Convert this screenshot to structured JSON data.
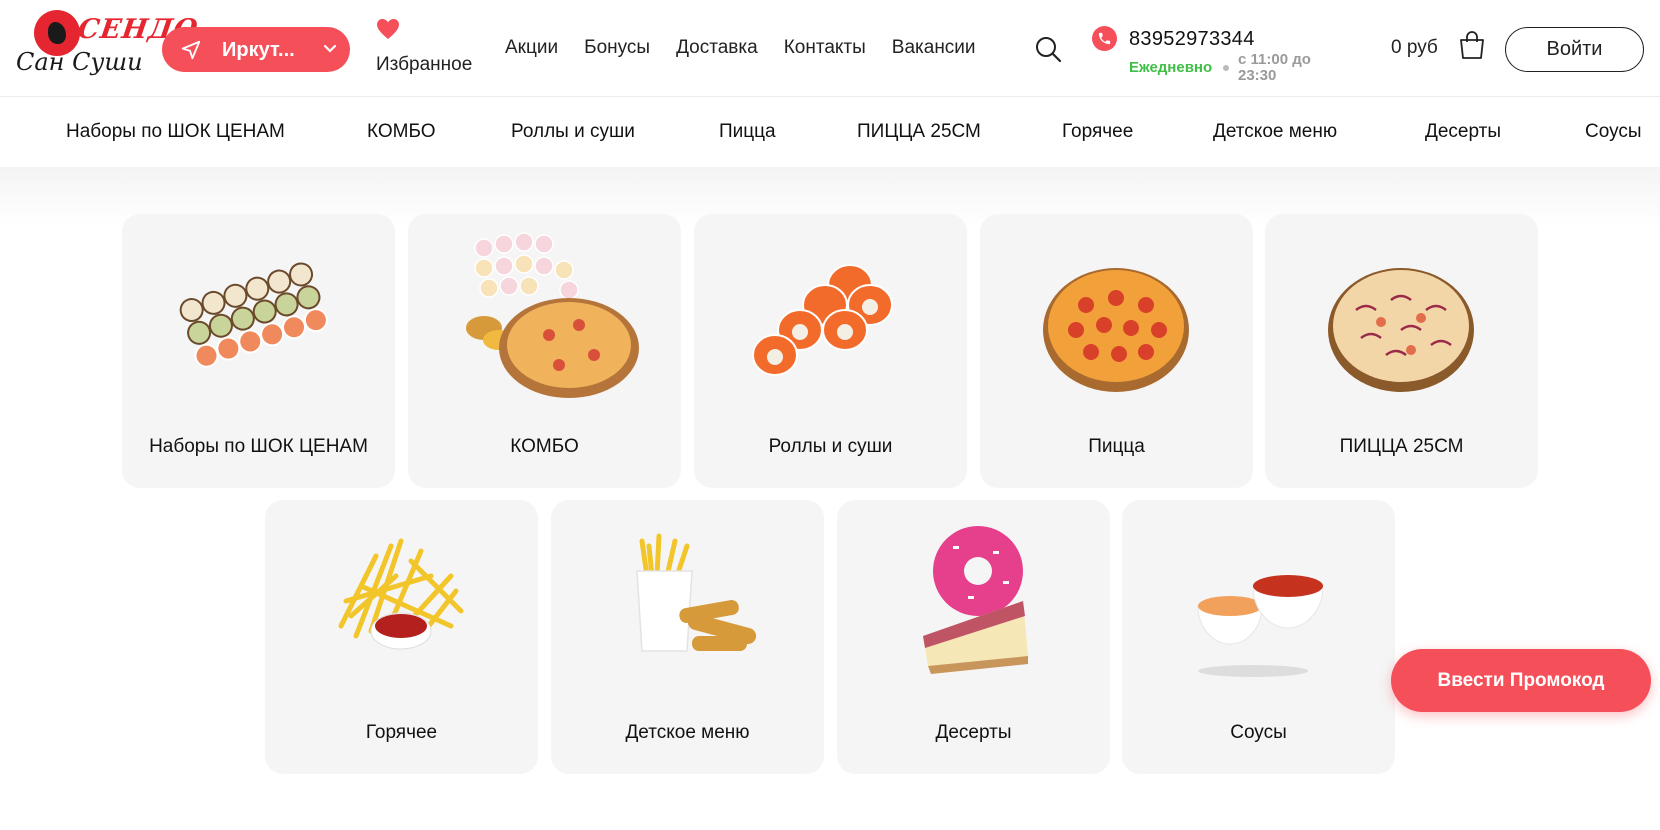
{
  "logo": {
    "top_text": "СЕНДО",
    "bottom_text": "Сан Суши"
  },
  "header": {
    "city": "Иркут...",
    "favorites": "Избранное",
    "nav": [
      "Акции",
      "Бонусы",
      "Доставка",
      "Контакты",
      "Вакансии"
    ],
    "phone": "83952973344",
    "schedule_days": "Ежедневно",
    "schedule_hours": "с 11:00 до 23:30",
    "cart_sum": "0 руб",
    "login": "Войти"
  },
  "categories_bar": [
    "Наборы по ШОК ЦЕНАМ",
    "КОМБО",
    "Роллы и суши",
    "Пицца",
    "ПИЦЦА 25СМ",
    "Горячее",
    "Детское меню",
    "Десерты",
    "Соусы"
  ],
  "cards": [
    {
      "label": "Наборы по ШОК ЦЕНАМ",
      "icon": "sushi-set-image"
    },
    {
      "label": "КОМБО",
      "icon": "combo-image"
    },
    {
      "label": "Роллы и суши",
      "icon": "rolls-image"
    },
    {
      "label": "Пицца",
      "icon": "pizza-image"
    },
    {
      "label": "ПИЦЦА 25СМ",
      "icon": "pizza-25-image"
    },
    {
      "label": "Горячее",
      "icon": "fries-image"
    },
    {
      "label": "Детское меню",
      "icon": "kids-menu-image"
    },
    {
      "label": "Десерты",
      "icon": "dessert-image"
    },
    {
      "label": "Соусы",
      "icon": "sauces-image"
    }
  ],
  "promo_button": "Ввести Промокод",
  "colors": {
    "accent": "#f54f5a",
    "brand_red": "#e52630",
    "open_green": "#3fbf46",
    "card_bg": "#f5f5f5"
  }
}
